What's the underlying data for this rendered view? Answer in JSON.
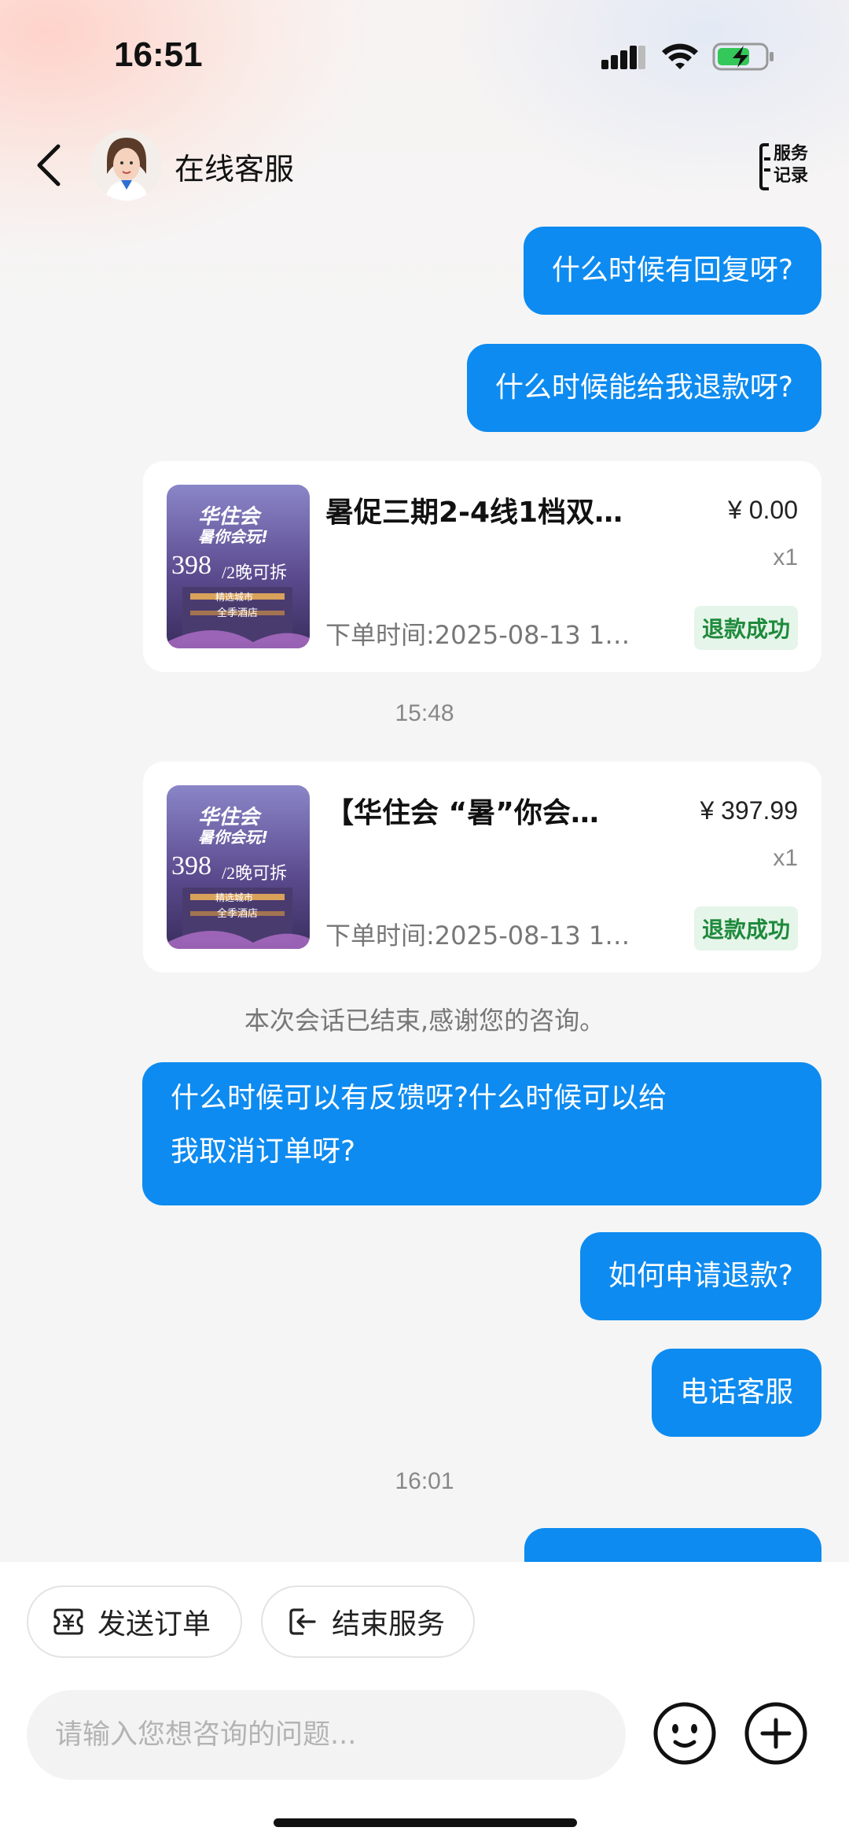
{
  "status_bar": {
    "time": "16:51"
  },
  "header": {
    "title": "在线客服",
    "records_label_1": "服务",
    "records_label_2": "记录"
  },
  "messages": {
    "m1": "什么时候有回复呀?",
    "m2": "什么时候能给我退款呀?",
    "m3_line1": "什么时候可以有反馈呀?什么时候可以给",
    "m3_line2": "我取消订单呀?",
    "m4": "如何申请退款?",
    "m5": "电话客服"
  },
  "cards": [
    {
      "title": "暑促三期2-4线1档双…",
      "price": "¥ 0.00",
      "qty": "x1",
      "time": "下单时间:2025-08-13 1…",
      "status": "退款成功",
      "thumb_line1": "华住会",
      "thumb_line2": "暑你会玩!",
      "thumb_price": "398",
      "thumb_unit": "/2晚可拆",
      "thumb_brand1": "精选城市",
      "thumb_brand2": "全季酒店"
    },
    {
      "title": "【华住会 “暑”你会…",
      "price": "¥ 397.99",
      "qty": "x1",
      "time": "下单时间:2025-08-13 1…",
      "status": "退款成功",
      "thumb_line1": "华住会",
      "thumb_line2": "暑你会玩!",
      "thumb_price": "398",
      "thumb_unit": "/2晚可拆",
      "thumb_brand1": "精选城市",
      "thumb_brand2": "全季酒店"
    }
  ],
  "timestamps": {
    "t1": "15:48",
    "t2": "16:01"
  },
  "system_message": "本次会话已结束,感谢您的咨询。",
  "actions": {
    "send_order": "发送订单",
    "end_service": "结束服务"
  },
  "input": {
    "placeholder": "请输入您想咨询的问题..."
  },
  "colors": {
    "accent": "#0d8bf0",
    "success": "#1e8a3c",
    "background": "#f5f5f5"
  }
}
